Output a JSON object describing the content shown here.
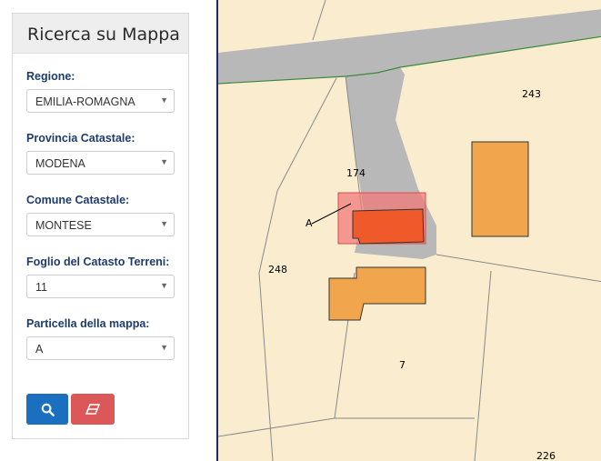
{
  "panel": {
    "title": "Ricerca su Mappa",
    "fields": [
      {
        "label": "Regione:",
        "value": "EMILIA-ROMAGNA"
      },
      {
        "label": "Provincia Catastale:",
        "value": "MODENA"
      },
      {
        "label": "Comune Catastale:",
        "value": "MONTESE"
      },
      {
        "label": "Foglio del Catasto Terreni:",
        "value": "11"
      },
      {
        "label": "Particella della mappa:",
        "value": "A"
      }
    ],
    "buttons": {
      "search_icon": "search-icon",
      "clear_icon": "eraser-icon"
    }
  },
  "map": {
    "parcels": [
      "243",
      "174",
      "248",
      "7",
      "226"
    ],
    "selected_parcel_label": "A",
    "colors": {
      "background": "#faeccf",
      "road": "#b8b8b8",
      "building": "#f1a54c",
      "selection": "#f07b7b",
      "selected_building": "#f05a2a",
      "road_edge": "#3a8a3a"
    }
  }
}
